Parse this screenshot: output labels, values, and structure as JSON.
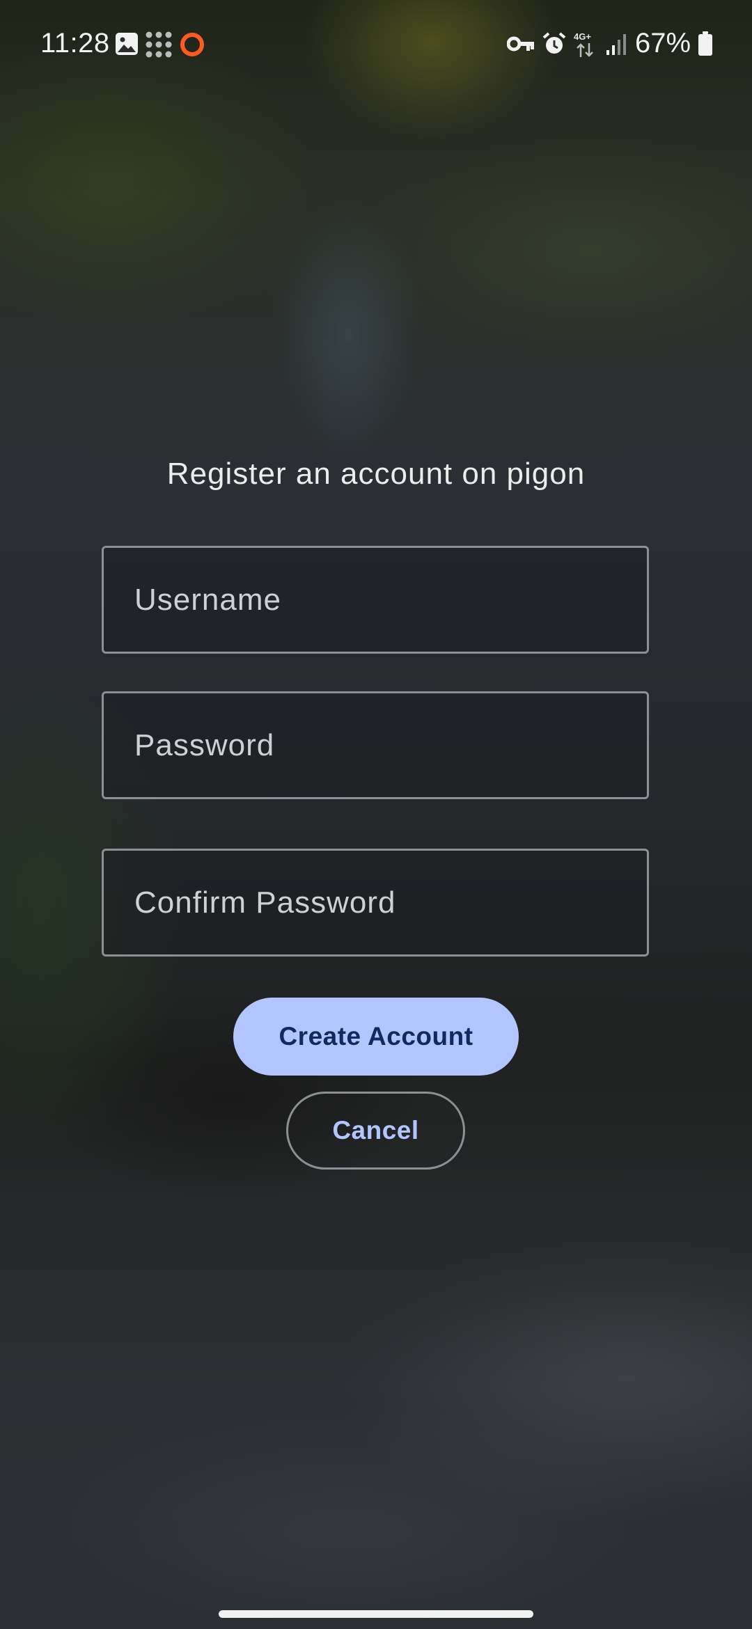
{
  "status_bar": {
    "time": "11:28",
    "network": "4G+",
    "battery_percent": "67%",
    "left_icons": [
      "gallery-icon",
      "apps-grid-icon",
      "record-circle-icon"
    ],
    "right_icons": [
      "vpn-key-icon",
      "alarm-icon",
      "mobile-data-icon",
      "signal-icon",
      "battery-icon"
    ],
    "record_icon_color": "#ff5a1f"
  },
  "register": {
    "title": "Register an account on pigon",
    "username_placeholder": "Username",
    "password_placeholder": "Password",
    "confirm_password_placeholder": "Confirm Password",
    "create_account_label": "Create Account",
    "cancel_label": "Cancel"
  },
  "colors": {
    "primary_button": "#b3c5ff",
    "primary_button_text": "#13295a",
    "outline": "#8d8f94"
  }
}
